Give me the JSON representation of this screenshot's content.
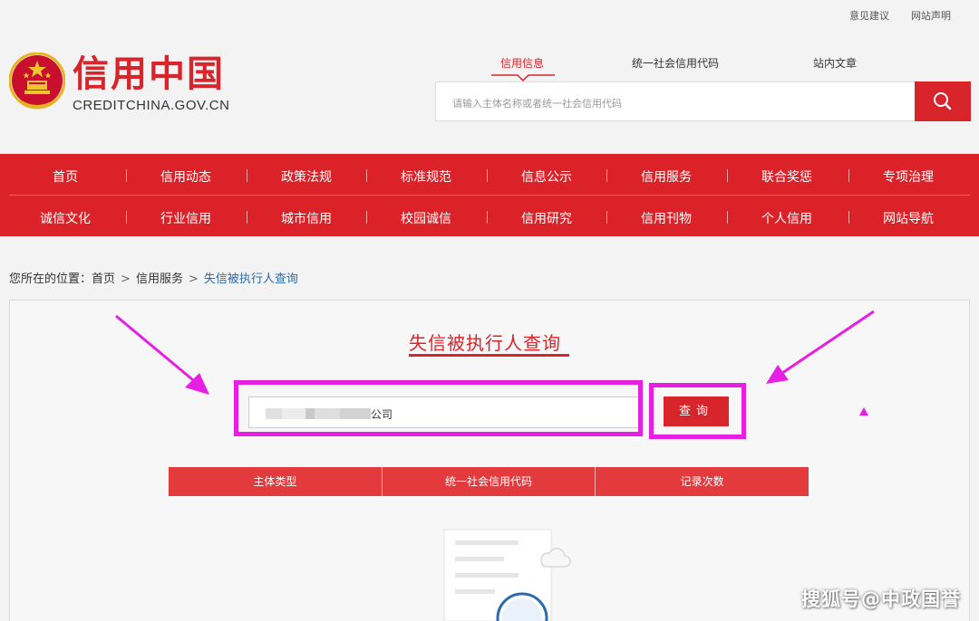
{
  "topbar": {
    "feedback": "意见建议",
    "statement": "网站声明"
  },
  "logo": {
    "title": "信用中国",
    "subtitle": "CREDITCHINA.GOV.CN"
  },
  "search": {
    "tabs": [
      "信用信息",
      "统一社会信用代码",
      "站内文章"
    ],
    "active_tab": "信用信息",
    "placeholder": "请输入主体名称或者统一社会信用代码"
  },
  "nav": {
    "row1": [
      "首页",
      "信用动态",
      "政策法规",
      "标准规范",
      "信息公示",
      "信用服务",
      "联合奖惩",
      "专项治理"
    ],
    "row2": [
      "诚信文化",
      "行业信用",
      "城市信用",
      "校园诚信",
      "信用研究",
      "信用刊物",
      "个人信用",
      "网站导航"
    ]
  },
  "breadcrumb": {
    "prefix": "您所在的位置：",
    "home": "首页",
    "section": "信用服务",
    "current": "失信被执行人查询",
    "sep": ">"
  },
  "query": {
    "title": "失信被执行人查询",
    "input_value_suffix": "公司",
    "button_label": "查询"
  },
  "table": {
    "columns": [
      "主体类型",
      "统一社会信用代码",
      "记录次数"
    ]
  },
  "watermark": "搜狐号@中政国誉",
  "colors": {
    "brand_red": "#d8242b",
    "annotation_magenta": "#e61fe3",
    "link_blue": "#2a6bb0"
  },
  "icons": {
    "search": "search-icon",
    "emblem": "national-emblem-icon"
  }
}
